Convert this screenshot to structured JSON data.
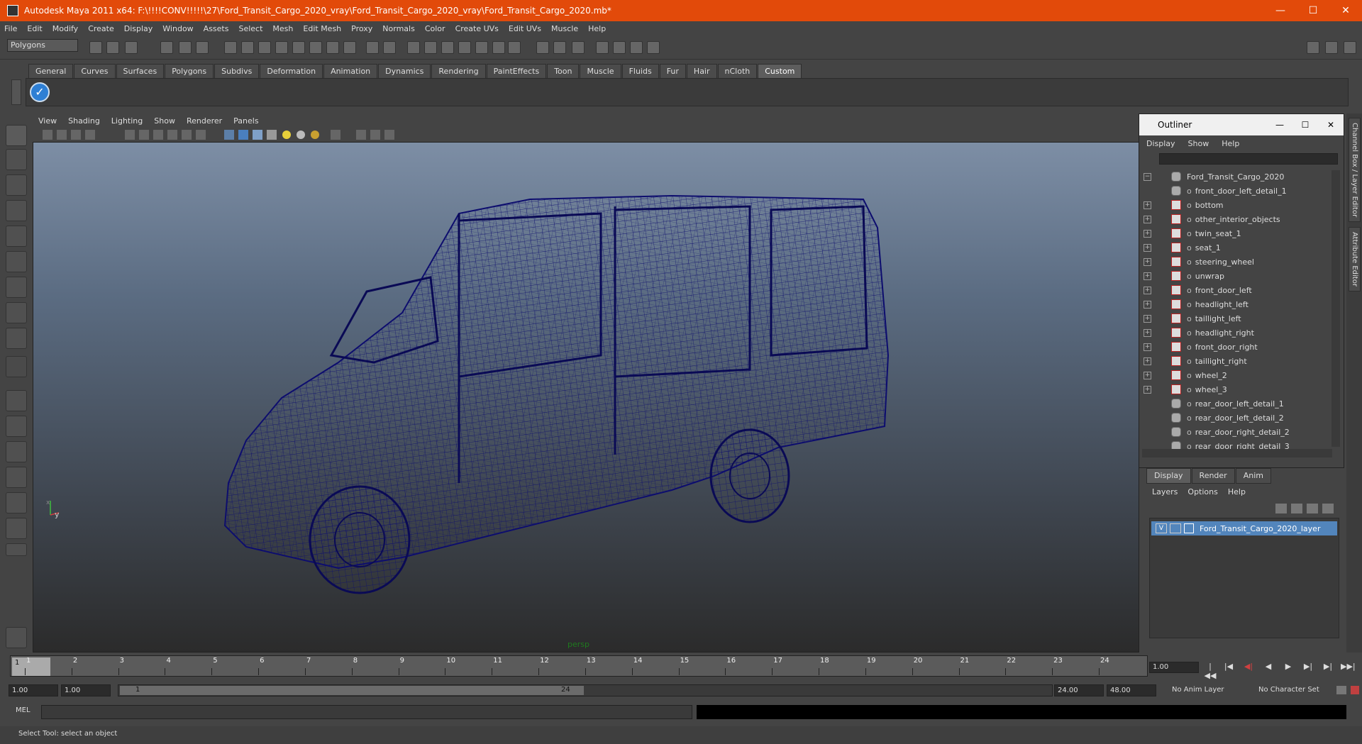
{
  "window": {
    "title": "Autodesk Maya 2011 x64: F:\\!!!!CONV!!!!!\\27\\Ford_Transit_Cargo_2020_vray\\Ford_Transit_Cargo_2020_vray\\Ford_Transit_Cargo_2020.mb*",
    "minimize": "—",
    "maximize": "☐",
    "close": "✕"
  },
  "menubar": [
    "File",
    "Edit",
    "Modify",
    "Create",
    "Display",
    "Window",
    "Assets",
    "Select",
    "Mesh",
    "Edit Mesh",
    "Proxy",
    "Normals",
    "Color",
    "Create UVs",
    "Edit UVs",
    "Muscle",
    "Help"
  ],
  "statusline": {
    "mode": "Polygons"
  },
  "shelf": {
    "tabs": [
      "General",
      "Curves",
      "Surfaces",
      "Polygons",
      "Subdivs",
      "Deformation",
      "Animation",
      "Dynamics",
      "Rendering",
      "PaintEffects",
      "Toon",
      "Muscle",
      "Fluids",
      "Fur",
      "Hair",
      "nCloth",
      "Custom"
    ],
    "active_tab": "Custom",
    "check_icon": "✓"
  },
  "viewport": {
    "menu": [
      "View",
      "Shading",
      "Lighting",
      "Show",
      "Renderer",
      "Panels"
    ],
    "camera_label": "persp",
    "axis_x": "x",
    "axis_y": "y",
    "wireframe_color": "#0d0d6e"
  },
  "outliner": {
    "title": "Outliner",
    "menu": [
      "Display",
      "Show",
      "Help"
    ],
    "root": "Ford_Transit_Cargo_2020",
    "items": [
      {
        "name": "front_door_left_detail_1",
        "expandable": false,
        "group": true
      },
      {
        "name": "bottom",
        "expandable": true,
        "group": false
      },
      {
        "name": "other_interior_objects",
        "expandable": true,
        "group": false
      },
      {
        "name": "twin_seat_1",
        "expandable": true,
        "group": false
      },
      {
        "name": "seat_1",
        "expandable": true,
        "group": false
      },
      {
        "name": "steering_wheel",
        "expandable": true,
        "group": false
      },
      {
        "name": "unwrap",
        "expandable": true,
        "group": false
      },
      {
        "name": "front_door_left",
        "expandable": true,
        "group": false
      },
      {
        "name": "headlight_left",
        "expandable": true,
        "group": false
      },
      {
        "name": "taillight_left",
        "expandable": true,
        "group": false
      },
      {
        "name": "headlight_right",
        "expandable": true,
        "group": false
      },
      {
        "name": "front_door_right",
        "expandable": true,
        "group": false
      },
      {
        "name": "taillight_right",
        "expandable": true,
        "group": false
      },
      {
        "name": "wheel_2",
        "expandable": true,
        "group": false
      },
      {
        "name": "wheel_3",
        "expandable": true,
        "group": false
      },
      {
        "name": "rear_door_left_detail_1",
        "expandable": false,
        "group": true
      },
      {
        "name": "rear_door_left_detail_2",
        "expandable": false,
        "group": true
      },
      {
        "name": "rear_door_right_detail_2",
        "expandable": false,
        "group": true
      },
      {
        "name": "rear_door_right_detail_3",
        "expandable": false,
        "group": true
      }
    ]
  },
  "layers": {
    "tabs": [
      "Display",
      "Render",
      "Anim"
    ],
    "active_tab": "Display",
    "menu": [
      "Layers",
      "Options",
      "Help"
    ],
    "rows": [
      {
        "visible": "V",
        "name": "Ford_Transit_Cargo_2020_layer"
      }
    ]
  },
  "sidetabs": [
    "Channel Box / Layer Editor",
    "Attribute Editor"
  ],
  "timeslider": {
    "current_frame_display": "1",
    "ticks": [
      1,
      2,
      3,
      4,
      5,
      6,
      7,
      8,
      9,
      10,
      11,
      12,
      13,
      14,
      15,
      16,
      17,
      18,
      19,
      20,
      21,
      22,
      23,
      24
    ],
    "current_frame_field": "1.00",
    "playback_buttons": [
      "|◀◀",
      "|◀",
      "◀|",
      "◀",
      "▶",
      "▶|",
      "▶|",
      "▶▶|"
    ]
  },
  "rangeslider": {
    "start_time": "1.00",
    "playback_start": "1.00",
    "range_start_label": "1",
    "range_end_label": "24",
    "playback_end": "24.00",
    "end_time": "48.00",
    "anim_layer": "No Anim Layer",
    "character_set": "No Character Set"
  },
  "cmdline": {
    "label": "MEL"
  },
  "helpline": {
    "text": "Select Tool: select an object"
  }
}
